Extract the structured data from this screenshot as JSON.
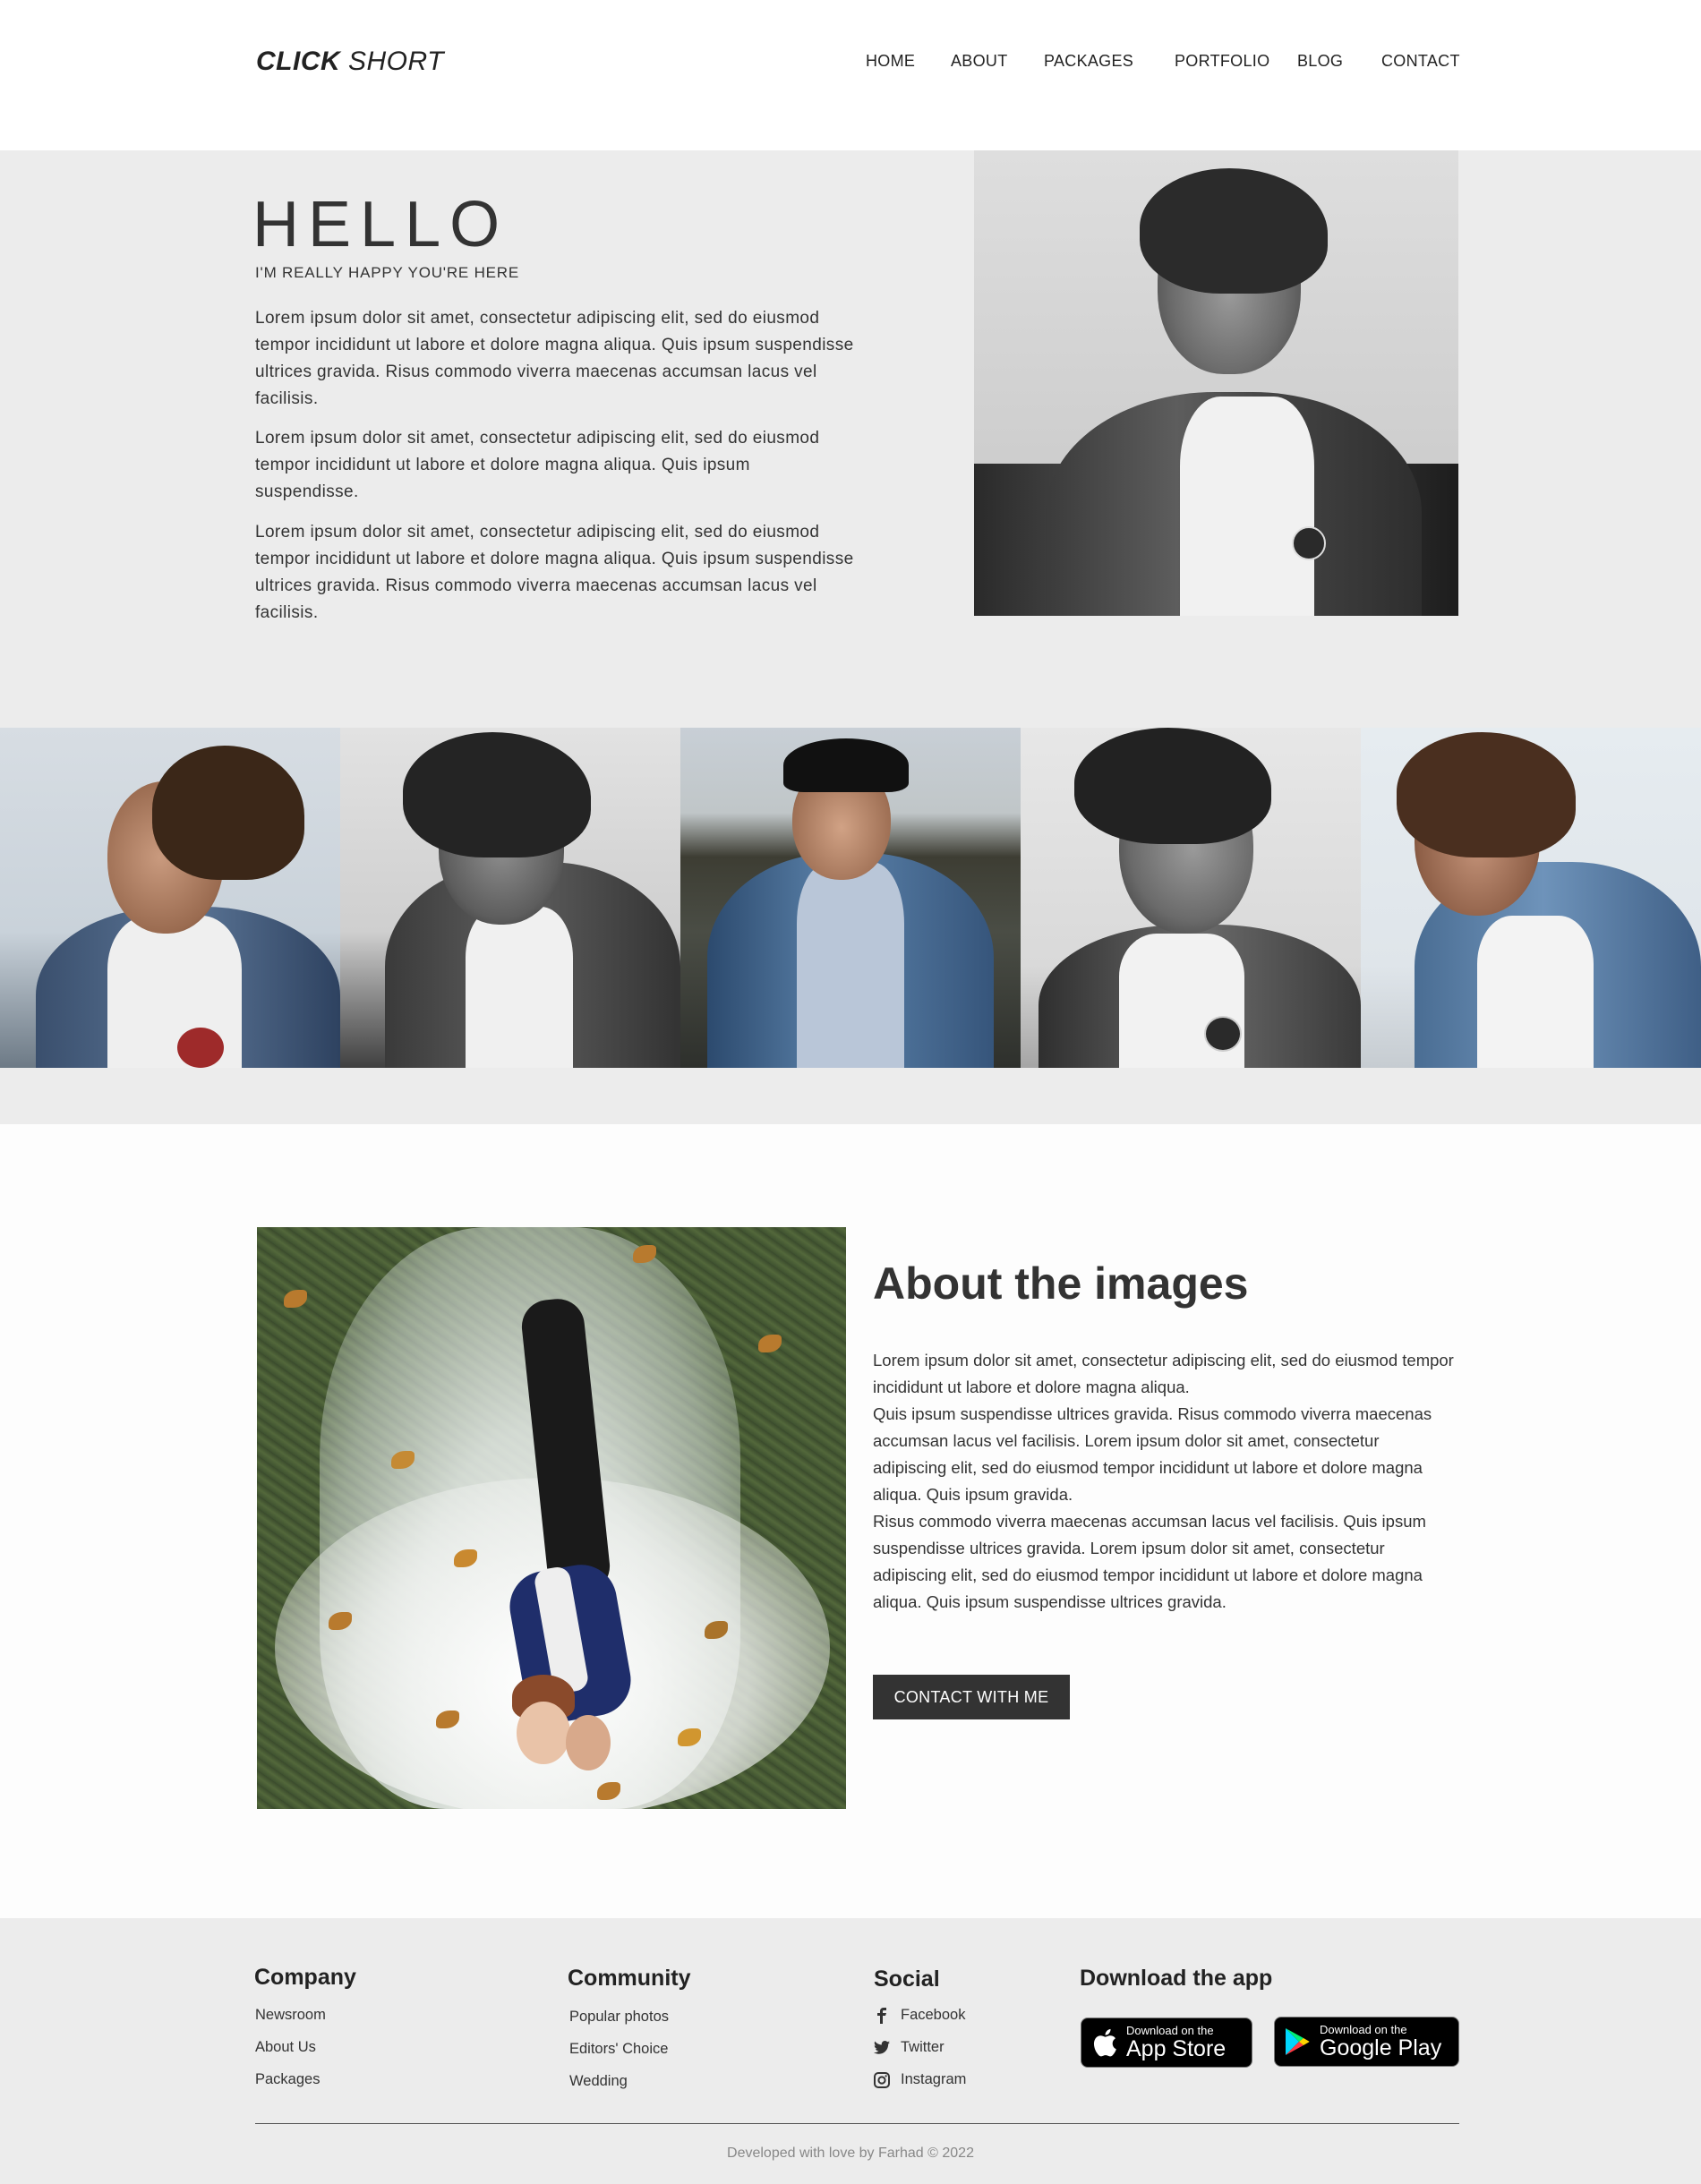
{
  "header": {
    "logo_bold": "CLICK",
    "logo_light": "SHORT",
    "nav": [
      "HOME",
      "ABOUT",
      "PACKAGES",
      "PORTFOLIO",
      "BLOG",
      "CONTACT"
    ]
  },
  "hero": {
    "title": "HELLO",
    "subtitle": "I'M REALLY HAPPY YOU'RE HERE",
    "paragraphs": [
      "Lorem ipsum dolor sit amet, consectetur adipiscing elit, sed do eiusmod tempor incididunt ut labore et dolore magna aliqua. Quis ipsum suspendisse ultrices gravida. Risus commodo viverra maecenas accumsan lacus vel facilisis.",
      "Lorem ipsum dolor sit amet, consectetur adipiscing elit, sed do eiusmod tempor incididunt ut labore et dolore magna aliqua. Quis ipsum suspendisse.",
      "Lorem ipsum dolor sit amet, consectetur adipiscing elit, sed do eiusmod tempor incididunt ut labore et dolore magna aliqua. Quis ipsum suspendisse ultrices gravida. Risus commodo viverra maecenas accumsan lacus vel facilisis."
    ]
  },
  "about": {
    "title": "About the images",
    "paragraphs": [
      "Lorem ipsum dolor sit amet, consectetur adipiscing elit, sed do eiusmod tempor incididunt ut labore et dolore magna aliqua.",
      "Quis ipsum suspendisse ultrices gravida. Risus commodo viverra maecenas accumsan lacus vel facilisis. Lorem ipsum dolor sit amet, consectetur adipiscing elit, sed do eiusmod tempor incididunt ut labore et dolore magna aliqua. Quis ipsum gravida.",
      "Risus commodo viverra maecenas accumsan lacus vel facilisis. Quis ipsum suspendisse ultrices gravida. Lorem ipsum dolor sit amet, consectetur adipiscing elit, sed do eiusmod tempor incididunt ut labore et dolore magna aliqua. Quis ipsum suspendisse ultrices gravida."
    ],
    "button": "CONTACT WITH ME"
  },
  "footer": {
    "company": {
      "heading": "Company",
      "links": [
        "Newsroom",
        "About Us",
        "Packages"
      ]
    },
    "community": {
      "heading": "Community",
      "links": [
        "Popular photos",
        "Editors' Choice",
        "Wedding"
      ]
    },
    "social": {
      "heading": "Social",
      "links": [
        {
          "label": "Facebook",
          "icon": "facebook-icon"
        },
        {
          "label": "Twitter",
          "icon": "twitter-icon"
        },
        {
          "label": "Instagram",
          "icon": "instagram-icon"
        }
      ]
    },
    "app": {
      "heading": "Download the app",
      "appstore_small": "Download on the",
      "appstore_big": "App Store",
      "googleplay_small": "Download on the",
      "googleplay_big": "Google Play"
    },
    "credit": "Developed with love by Farhad © 2022"
  },
  "colors": {
    "text": "#333333",
    "hero_bg": "#ececec",
    "button_bg": "#333333",
    "footer_bg": "#ececec"
  }
}
